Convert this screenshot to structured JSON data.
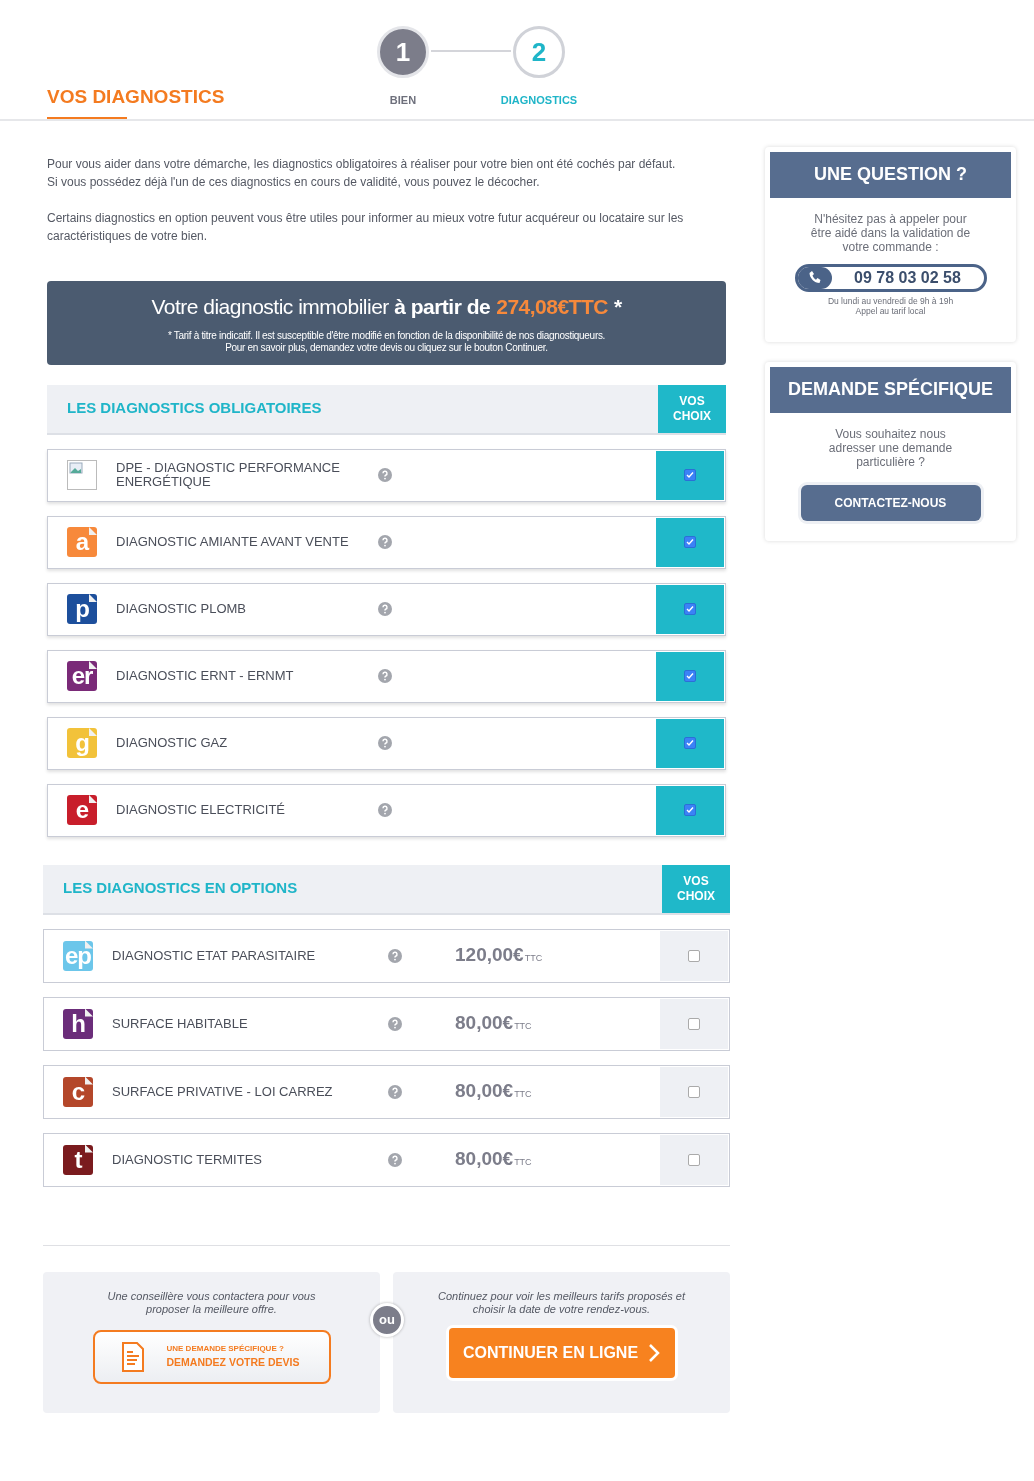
{
  "steps": [
    {
      "number": "1",
      "label": "BIEN",
      "selected": false
    },
    {
      "number": "2",
      "label": "DIAGNOSTICS",
      "selected": true
    }
  ],
  "title": "VOS DIAGNOSTICS",
  "intro": [
    "Pour vous aider dans votre démarche, les diagnostics obligatoires à réaliser pour votre bien ont été cochés par défaut.",
    "Si vous possédez déjà l'un de ces diagnostics en cours de validité, vous pouvez le décocher.",
    "Certains diagnostics en option peuvent vous être utiles pour informer au mieux votre futur acquéreur ou locataire sur les caractéristiques de votre bien."
  ],
  "banner": {
    "headline": "Votre diagnostic immobilier **à partir de**",
    "price": "274,08€TTC",
    "star": "*",
    "note_1": "* Tarif à titre indicatif. Il est susceptible d'être modifié en fonction de la disponibilité de nos diagnostiqueurs.",
    "note_2": "Pour en savoir plus, demandez votre devis ou cliquez sur le bouton Continuer."
  },
  "required": {
    "heading": "LES DIAGNOSTICS OBLIGATOIRES",
    "choice_header": "VOS CHOIX",
    "items": [
      {
        "name": "DPE - DIAGNOSTIC PERFORMANCE ENERGÉTIQUE",
        "icon": {
          "kind": "broken"
        },
        "checked": true
      },
      {
        "name": "DIAGNOSTIC AMIANTE AVANT VENTE",
        "icon": {
          "kind": "tile",
          "letter": "a",
          "color": "#f7893b"
        },
        "checked": true
      },
      {
        "name": "DIAGNOSTIC PLOMB",
        "icon": {
          "kind": "tile",
          "letter": "p",
          "color": "#1d4f9c"
        },
        "checked": true
      },
      {
        "name": "DIAGNOSTIC ERNT - ERNMT",
        "icon": {
          "kind": "tile",
          "letter": "er",
          "color": "#7a2a78"
        },
        "checked": true
      },
      {
        "name": "DIAGNOSTIC GAZ",
        "icon": {
          "kind": "tile",
          "letter": "g",
          "color": "#f2c23a"
        },
        "checked": true
      },
      {
        "name": "DIAGNOSTIC ELECTRICITÉ",
        "icon": {
          "kind": "tile",
          "letter": "e",
          "color": "#c81e2b"
        },
        "checked": true
      }
    ]
  },
  "options": {
    "heading": "LES DIAGNOSTICS EN OPTIONS",
    "choice_header": "VOS CHOIX",
    "items": [
      {
        "name": "DIAGNOSTIC ETAT PARASITAIRE",
        "icon": {
          "kind": "tile",
          "letter": "ep",
          "color": "#6cc6ea"
        },
        "price": "120,00€",
        "tax": "TTC",
        "checked": false
      },
      {
        "name": "SURFACE HABITABLE",
        "icon": {
          "kind": "tile",
          "letter": "h",
          "color": "#6b2d7a"
        },
        "price": "80,00€",
        "tax": "TTC",
        "checked": false
      },
      {
        "name": "SURFACE PRIVATIVE - LOI CARREZ",
        "icon": {
          "kind": "tile",
          "letter": "c",
          "color": "#b4472a"
        },
        "price": "80,00€",
        "tax": "TTC",
        "checked": false
      },
      {
        "name": "DIAGNOSTIC TERMITES",
        "icon": {
          "kind": "tile",
          "letter": "t",
          "color": "#7a1b1e"
        },
        "price": "80,00€",
        "tax": "TTC",
        "checked": false
      }
    ]
  },
  "quote_box": {
    "text": "Une conseillère vous contactera pour vous proposer la meilleure offre.",
    "button_small": "UNE DEMANDE SPÉCIFIQUE ?",
    "button_main": "DEMANDEZ VOTRE DEVIS"
  },
  "separator": "ou",
  "continue_box": {
    "text": "Continuez pour voir les meilleurs tarifs proposés et choisir la date de votre rendez-vous.",
    "button": "CONTINUER EN LIGNE"
  },
  "question_card": {
    "title": "UNE QUESTION ?",
    "text": "N'hésitez pas à appeler pour être aidé dans la validation de votre commande :",
    "phone": "09 78 03 02 58",
    "hours": "Du lundi au vendredi de 9h à 19h",
    "tariff": "Appel au tarif local"
  },
  "request_card": {
    "title": "DEMANDE SPÉCIFIQUE",
    "text": "Vous souhaitez nous adresser une demande particulière ?",
    "button": "CONTACTEZ-NOUS"
  }
}
